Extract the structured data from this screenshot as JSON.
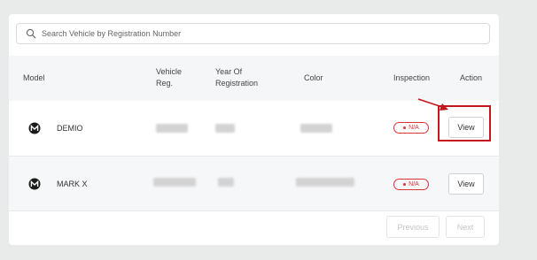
{
  "search": {
    "placeholder": "Search Vehicle by Registration Number",
    "icon": "search-icon"
  },
  "table": {
    "headers": {
      "model": "Model",
      "vehicle_reg": "Vehicle\nReg.",
      "year": "Year Of\nRegistration",
      "color": "Color",
      "inspection": "Inspection",
      "action": "Action"
    },
    "rows": [
      {
        "logo": "mazda-logo-icon",
        "model": "DEMIO",
        "vehicle_reg": "",
        "year": "",
        "color": "",
        "inspection": "N/A",
        "action": "View"
      },
      {
        "logo": "mazda-logo-icon",
        "model": "MARK X",
        "vehicle_reg": "",
        "year": "",
        "color": "",
        "inspection": "N/A",
        "action": "View"
      }
    ]
  },
  "pagination": {
    "previous": "Previous",
    "next": "Next"
  },
  "colors": {
    "background": "#e9ebea",
    "header": "#f5f6f7",
    "status_red": "#e0323b",
    "highlight": "#c4161c"
  }
}
